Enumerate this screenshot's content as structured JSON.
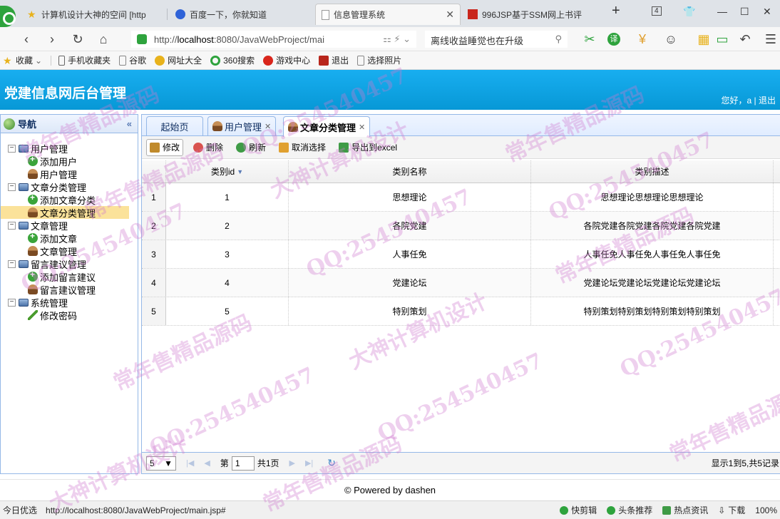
{
  "browser": {
    "tabs": [
      {
        "title": "计算机设计大神的空间 [http",
        "active": false,
        "icon": "star-icon"
      },
      {
        "title": "百度一下，你就知道",
        "active": false,
        "icon": "baidu-paw-icon"
      },
      {
        "title": "信息管理系统",
        "active": true,
        "icon": "page-icon"
      },
      {
        "title": "996JSP基于SSM网上书评",
        "active": false,
        "icon": "red-site-icon"
      }
    ],
    "tab_counter": "4",
    "url_prefix": "http://",
    "url_host": "localhost",
    "url_rest": ":8080/JavaWebProject/mai",
    "search_text": "离线收益睡觉也在升级",
    "bookmarks": [
      {
        "label": "收藏",
        "icon": "star-icon"
      },
      {
        "label": "手机收藏夹",
        "icon": "phone-icon"
      },
      {
        "label": "谷歌",
        "icon": "page-icon"
      },
      {
        "label": "网址大全",
        "icon": "compass-icon"
      },
      {
        "label": "360搜索",
        "icon": "search-360-icon"
      },
      {
        "label": "游戏中心",
        "icon": "game-icon"
      },
      {
        "label": "退出",
        "icon": "exit-icon"
      },
      {
        "label": "选择照片",
        "icon": "page-icon"
      }
    ]
  },
  "app": {
    "title": "党建信息网后台管理",
    "greeting": "您好，a",
    "separator": " | ",
    "logout": "退出"
  },
  "sidebar": {
    "title": "导航",
    "collapse_symbol": "«",
    "tree": [
      {
        "label": "用户管理",
        "children": [
          "添加用户",
          "用户管理"
        ],
        "child_icons": [
          "add",
          "user"
        ]
      },
      {
        "label": "文章分类管理",
        "children": [
          "添加文章分类",
          "文章分类管理"
        ],
        "child_icons": [
          "add",
          "user"
        ]
      },
      {
        "label": "文章管理",
        "children": [
          "添加文章",
          "文章管理"
        ],
        "child_icons": [
          "add",
          "user"
        ]
      },
      {
        "label": "留言建议管理",
        "children": [
          "添加留言建议",
          "留言建议管理"
        ],
        "child_icons": [
          "add",
          "user"
        ]
      },
      {
        "label": "系统管理",
        "children": [
          "修改密码"
        ],
        "child_icons": [
          "pencil"
        ]
      }
    ],
    "selected": "文章分类管理"
  },
  "main": {
    "tabs": [
      {
        "label": "起始页",
        "closable": false
      },
      {
        "label": "用户管理",
        "closable": true
      },
      {
        "label": "文章分类管理",
        "closable": true,
        "active": true
      }
    ],
    "toolbar": [
      {
        "label": "修改",
        "icon": "edit-icon",
        "color": "#c08a2c"
      },
      {
        "label": "删除",
        "icon": "delete-icon",
        "color": "#d9534f"
      },
      {
        "label": "刷新",
        "icon": "refresh-icon",
        "color": "#3f9b46"
      },
      {
        "label": "取消选择",
        "icon": "undo-icon",
        "color": "#e0a030"
      },
      {
        "label": "导出到excel",
        "icon": "export-icon",
        "color": "#3f9b46"
      }
    ],
    "grid": {
      "columns": [
        "类别id",
        "类别名称",
        "类别描述"
      ],
      "rows": [
        {
          "num": "1",
          "id": "1",
          "name": "思想理论",
          "desc": "思想理论思想理论思想理论"
        },
        {
          "num": "2",
          "id": "2",
          "name": "各院党建",
          "desc": "各院党建各院党建各院党建各院党建"
        },
        {
          "num": "3",
          "id": "3",
          "name": "人事任免",
          "desc": "人事任免人事任免人事任免人事任免"
        },
        {
          "num": "4",
          "id": "4",
          "name": "党建论坛",
          "desc": "党建论坛党建论坛党建论坛党建论坛"
        },
        {
          "num": "5",
          "id": "5",
          "name": "特别策划",
          "desc": "特别策划特别策划特别策划特别策划"
        }
      ]
    },
    "pager": {
      "page_size": "5",
      "page_label": "第",
      "page_value": "1",
      "total_pages": "共1页",
      "info": "显示1到5,共5记录"
    }
  },
  "footer": "© Powered by dashen",
  "statusbar": {
    "left": "今日优选",
    "url": "http://localhost:8080/JavaWebProject/main.jsp#",
    "items": [
      "快剪辑",
      "头条推荐",
      "热点资讯",
      "下载"
    ],
    "zoom": "100%"
  },
  "watermarks": [
    "常年售精品源码",
    "QQ:254540457",
    "大神计算机设计"
  ]
}
